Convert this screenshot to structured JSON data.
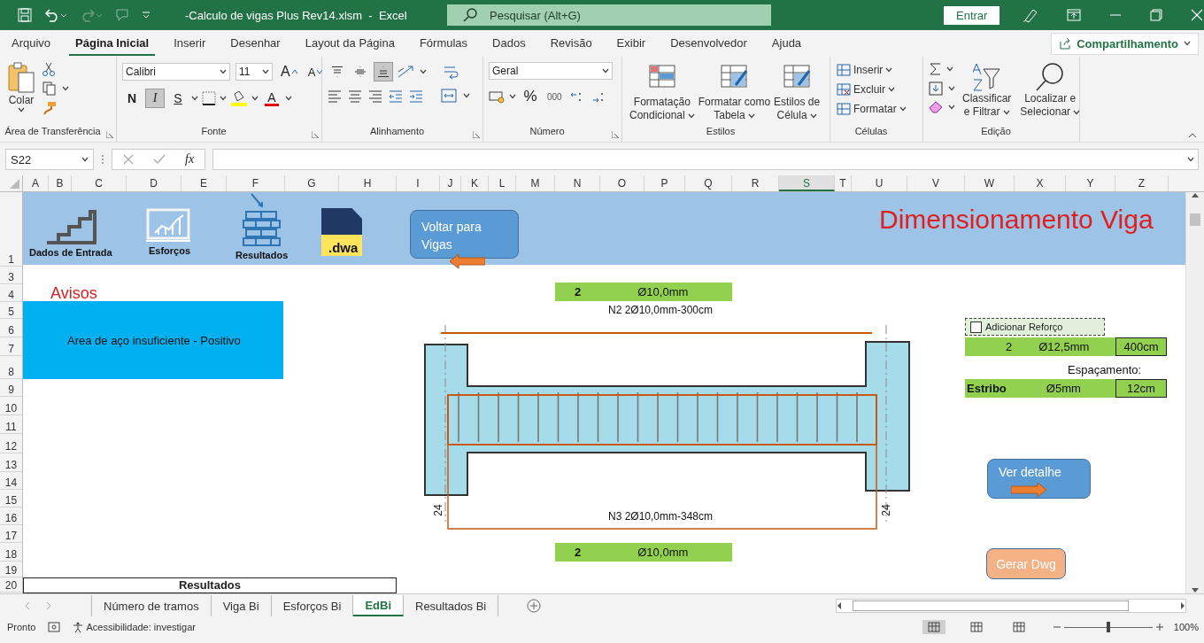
{
  "title_bar": {
    "title": "-Calculo de vigas Plus Rev14.xlsm  -  Excel",
    "search": {
      "placeholder": "Pesquisar (Alt+G)"
    },
    "sign_in": "Entrar",
    "redo": {
      "disabled": true
    }
  },
  "menu_tabs": [
    {
      "label": "Arquivo",
      "selected": false
    },
    {
      "label": "Página Inicial",
      "selected": true
    },
    {
      "label": "Inserir",
      "selected": false
    },
    {
      "label": "Desenhar",
      "selected": false
    },
    {
      "label": "Layout da Página",
      "selected": false
    },
    {
      "label": "Fórmulas",
      "selected": false
    },
    {
      "label": "Dados",
      "selected": false
    },
    {
      "label": "Revisão",
      "selected": false
    },
    {
      "label": "Exibir",
      "selected": false
    },
    {
      "label": "Desenvolvedor",
      "selected": false
    },
    {
      "label": "Ajuda",
      "selected": false
    }
  ],
  "share_button": "Compartilhamento",
  "ribbon": {
    "clipboard": {
      "paste": "Colar",
      "label": "Área de Transferência"
    },
    "font": {
      "family": "Calibri",
      "size": "11",
      "grow": "A",
      "shrink": "A",
      "styles": [
        {
          "label": "N",
          "selected": false
        },
        {
          "label": "I",
          "selected": true
        },
        {
          "label": "S",
          "selected": false
        }
      ],
      "font_color": "A",
      "label": "Fonte"
    },
    "alignment": {
      "vertical": [
        {
          "selected": false
        },
        {
          "selected": false
        },
        {
          "selected": true
        }
      ],
      "label": "Alinhamento"
    },
    "number": {
      "format": "Geral",
      "percent": "%",
      "thousands": "000",
      "label": "Número"
    },
    "styles": {
      "buttons": [
        [
          "Formatação",
          "Condicional"
        ],
        [
          "Formatar como",
          "Tabela"
        ],
        [
          "Estilos de",
          "Célula"
        ]
      ],
      "label": "Estilos"
    },
    "cells": {
      "buttons": [
        "Inserir",
        "Excluir",
        "Formatar"
      ],
      "label": "Células"
    },
    "editing": {
      "sort": [
        "Classificar",
        "e Filtrar"
      ],
      "find": [
        "Localizar e",
        "Selecionar"
      ],
      "label": "Edição"
    }
  },
  "formula_bar": {
    "name_box": "S22",
    "function_label": "fx"
  },
  "sheet": {
    "columns": [
      {
        "label": "A",
        "selected": false
      },
      {
        "label": "B",
        "selected": false
      },
      {
        "label": "C",
        "selected": false
      },
      {
        "label": "D",
        "selected": false
      },
      {
        "label": "E",
        "selected": false
      },
      {
        "label": "F",
        "selected": false
      },
      {
        "label": "G",
        "selected": false
      },
      {
        "label": "H",
        "selected": false
      },
      {
        "label": "I",
        "selected": false
      },
      {
        "label": "J",
        "selected": false
      },
      {
        "label": "K",
        "selected": false
      },
      {
        "label": "L",
        "selected": false
      },
      {
        "label": "M",
        "selected": false
      },
      {
        "label": "N",
        "selected": false
      },
      {
        "label": "O",
        "selected": false
      },
      {
        "label": "P",
        "selected": false
      },
      {
        "label": "Q",
        "selected": false
      },
      {
        "label": "R",
        "selected": false
      },
      {
        "label": "S",
        "selected": true
      },
      {
        "label": "T",
        "selected": false
      },
      {
        "label": "U",
        "selected": false
      },
      {
        "label": "V",
        "selected": false
      },
      {
        "label": "W",
        "selected": false
      },
      {
        "label": "X",
        "selected": false
      },
      {
        "label": "Y",
        "selected": false
      },
      {
        "label": "Z",
        "selected": false
      }
    ],
    "rows": [
      "1",
      "3",
      "4",
      "5",
      "6",
      "7",
      "8",
      "9",
      "10",
      "11",
      "12",
      "13",
      "14",
      "15",
      "16",
      "17",
      "18",
      "19",
      "20"
    ],
    "nav_buttons": [
      "Dados de Entrada",
      "Esforços",
      "Resultados"
    ],
    "dwg_icon_text": ".dwa",
    "back_button": "Voltar para Vigas",
    "title": "Dimensionamento Viga",
    "warnings": {
      "title": "Avisos",
      "message": "Area de aço insuficiente - Positivo"
    },
    "top_bar": {
      "count": "2",
      "diameter": "Ø10,0mm"
    },
    "top_label": "N2 2Ø10,0mm-300cm",
    "bottom_label": "N3 2Ø10,0mm-348cm",
    "anchorage": [
      "24",
      "24"
    ],
    "bottom_bar": {
      "count": "2",
      "diameter": "Ø10,0mm"
    },
    "reinforcement": {
      "label": "Adicionar Reforço",
      "checked": false,
      "count": "2",
      "diameter": "Ø12,5mm",
      "length": "400cm"
    },
    "spacing_label": "Espaçamento:",
    "stirrup": {
      "label": "Estribo",
      "diameter": "Ø5mm",
      "spacing": "12cm"
    },
    "detail_button": "Ver detalhe",
    "dwg_button": "Gerar Dwg",
    "results_header": "Resultados"
  },
  "sheet_tabs": [
    {
      "label": "Número de tramos",
      "selected": false
    },
    {
      "label": "Viga Bi",
      "selected": false
    },
    {
      "label": "Esforços Bi",
      "selected": false
    },
    {
      "label": "EdBi",
      "selected": true
    },
    {
      "label": "Resultados Bi",
      "selected": false
    }
  ],
  "status_bar": {
    "status": "Pronto",
    "accessibility": "Acessibilidade: investigar",
    "views": [
      {
        "selected": true
      },
      {
        "selected": false
      },
      {
        "selected": false
      }
    ],
    "zoom": {
      "level": 0.5,
      "reading": "100%"
    }
  }
}
